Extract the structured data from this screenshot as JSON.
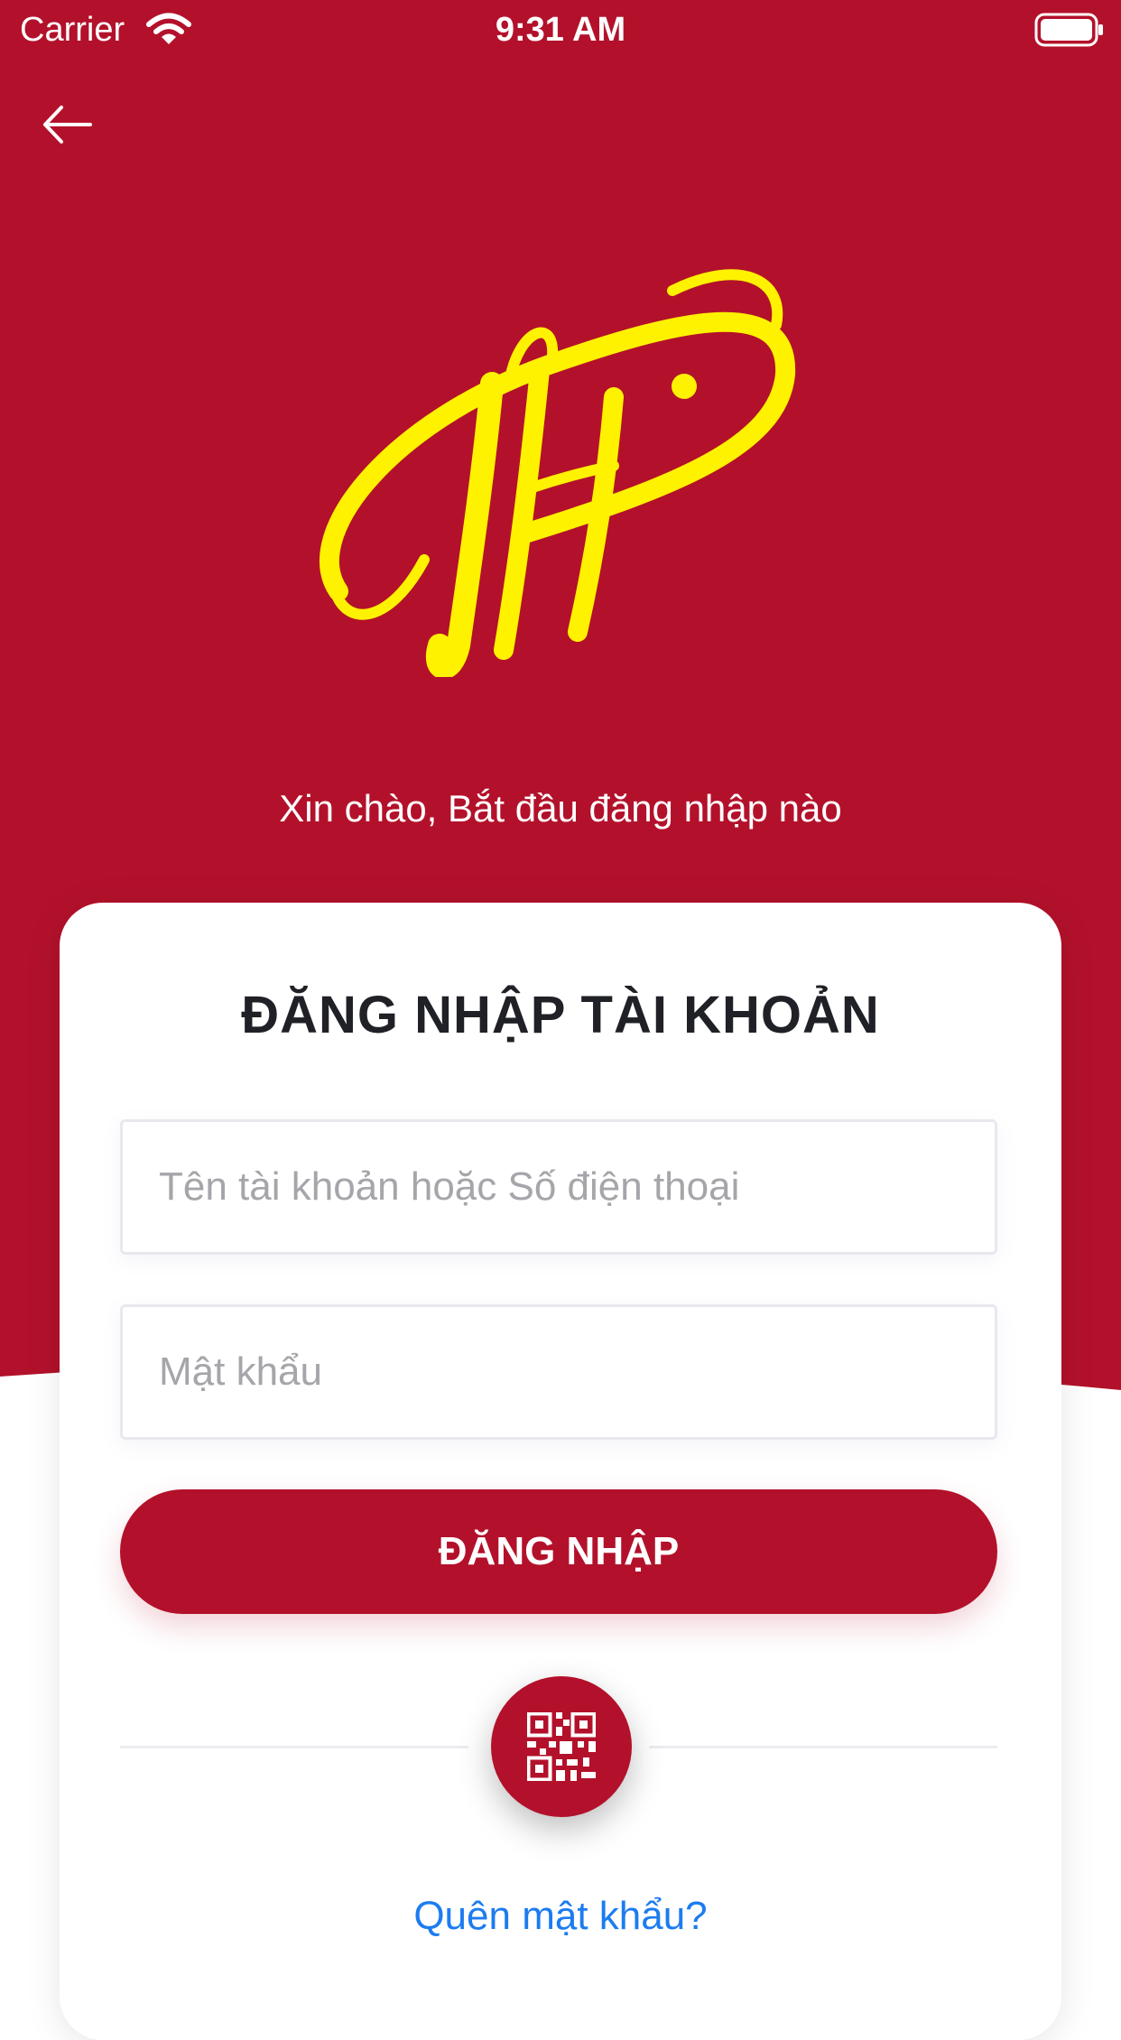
{
  "status_bar": {
    "carrier": "Carrier",
    "time": "9:31 AM",
    "wifi_icon": "wifi-icon",
    "battery_icon": "battery-icon"
  },
  "header": {
    "back_icon": "arrow-left-icon"
  },
  "logo": {
    "name": "th-script-logo",
    "color": "#fff200"
  },
  "greeting": "Xin chào, Bắt đầu đăng nhập nào",
  "login_card": {
    "title": "ĐĂNG NHẬP TÀI KHOẢN",
    "username": {
      "placeholder": "Tên tài khoản hoặc Số điện thoại",
      "value": ""
    },
    "password": {
      "placeholder": "Mật khẩu",
      "value": ""
    },
    "submit_label": "ĐĂNG NHẬP",
    "qr_icon": "qr-code-icon",
    "forgot_password": "Quên mật khẩu?"
  },
  "colors": {
    "brand_red": "#b3112b",
    "logo_yellow": "#fff200",
    "link_blue": "#1c7cf0",
    "title_text": "#1f2126",
    "placeholder_text": "#a5a5aa"
  }
}
